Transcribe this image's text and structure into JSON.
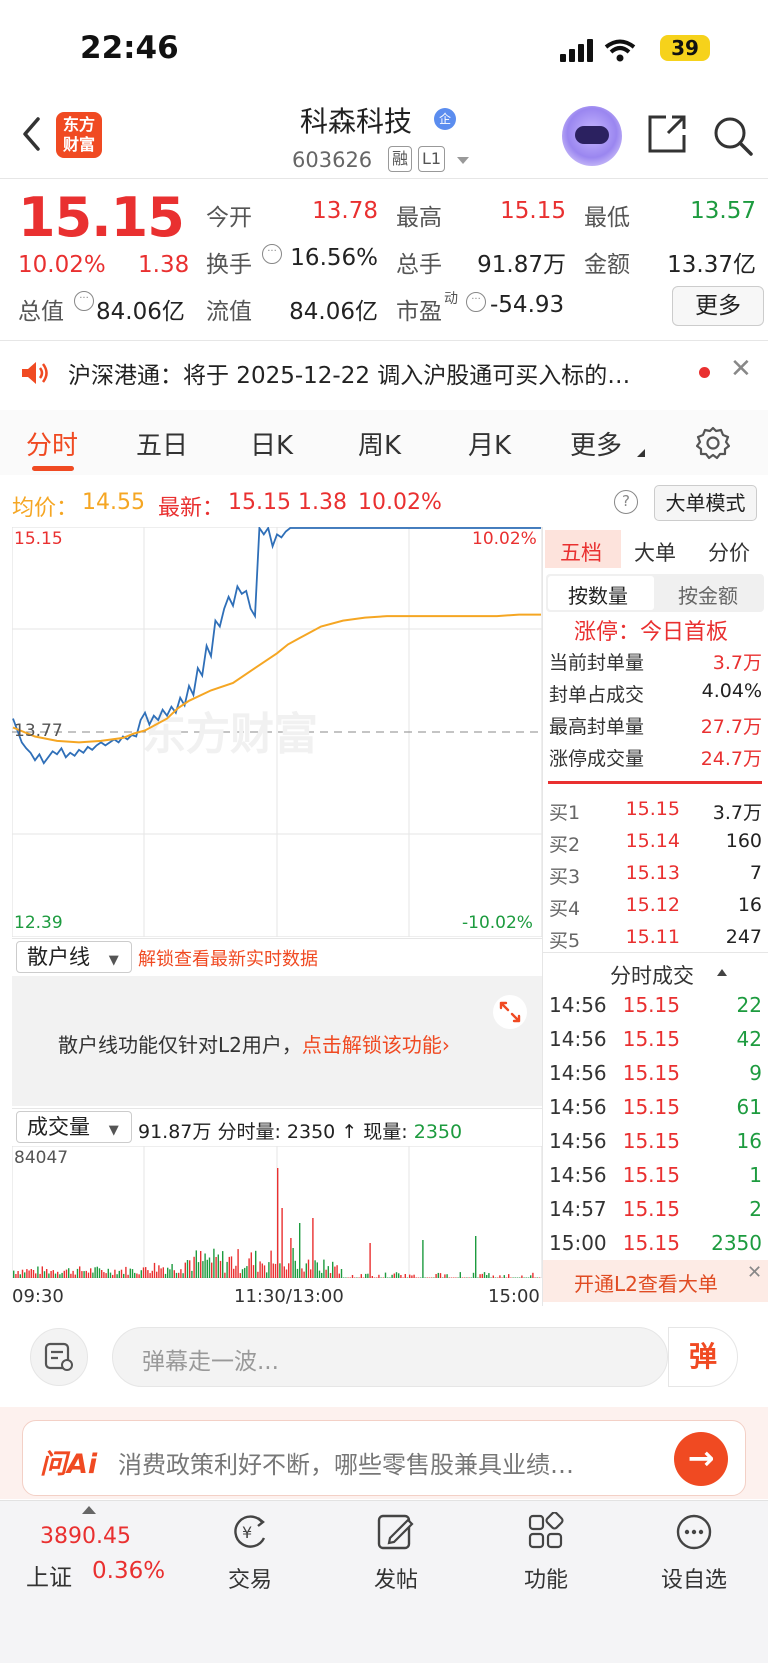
{
  "status_bar": {
    "time": "22:46",
    "battery": "39"
  },
  "header": {
    "logo_text": "东方财富",
    "stock_name": "科森科技",
    "name_badge": "企",
    "stock_code": "603626",
    "tag_margin": "融",
    "tag_level": "L1"
  },
  "quote": {
    "price": "15.15",
    "change_pct": "10.02%",
    "change": "1.38",
    "open_label": "今开",
    "open": "13.78",
    "high_label": "最高",
    "high": "15.15",
    "low_label": "最低",
    "low": "13.57",
    "turnover_label": "换手",
    "turnover": "16.56%",
    "volume_label": "总手",
    "volume": "91.87万",
    "amount_label": "金额",
    "amount": "13.37亿",
    "mktcap_label": "总值",
    "mktcap": "84.06亿",
    "float_label": "流值",
    "float_cap": "84.06亿",
    "pe_label": "市盈",
    "pe_sup": "动",
    "pe": "-54.93",
    "more_btn": "更多"
  },
  "notice": {
    "text": "沪深港通：将于 2025-12-22 调入沪股通可买入标的…"
  },
  "tabs": [
    "分时",
    "五日",
    "日K",
    "周K",
    "月K",
    "更多"
  ],
  "info_row": {
    "avg_label": "均价：",
    "avg": "14.55",
    "latest_label": "最新：",
    "latest": "15.15",
    "latest_chg": "1.38",
    "latest_pct": "10.02%",
    "big_order_btn": "大单模式"
  },
  "chart_labels": {
    "y_top": "15.15",
    "y_top_pct": "10.02%",
    "y_mid": "13.77",
    "y_bot": "12.39",
    "y_bot_pct": "-10.02%",
    "watermark": "东方财富"
  },
  "chart_data": {
    "type": "line",
    "title": "",
    "x_range": [
      "09:30",
      "15:00"
    ],
    "ylim": [
      12.39,
      15.15
    ],
    "prev_close": 13.77,
    "series": [
      {
        "name": "",
        "color": "#2f6fb8",
        "x": [
          0,
          2,
          4,
          6,
          8,
          10,
          12,
          14,
          16,
          18,
          20,
          22,
          24,
          26,
          28,
          30,
          32,
          34,
          36,
          38,
          40,
          42,
          44,
          46,
          48,
          50,
          52,
          54,
          56,
          58,
          60,
          62,
          64,
          66,
          68,
          70,
          72,
          74,
          76,
          78,
          80,
          82,
          84,
          86,
          88,
          90,
          92,
          94,
          96,
          98,
          100,
          102,
          104,
          106,
          108,
          110,
          112,
          114,
          116,
          118,
          120,
          122,
          124,
          126,
          128,
          130,
          132,
          134,
          136,
          138,
          140,
          142,
          144,
          146,
          148,
          150,
          152,
          154,
          156,
          158,
          160,
          162,
          164,
          166,
          168,
          170,
          172,
          174,
          176,
          178,
          180,
          182,
          184,
          186,
          188,
          190,
          192,
          194,
          196,
          198,
          200,
          202,
          204,
          206,
          208,
          210,
          212,
          214,
          216,
          218,
          220,
          222,
          224,
          226,
          228,
          230,
          232,
          234,
          236,
          238,
          240
        ],
        "y": [
          13.86,
          13.78,
          13.7,
          13.66,
          13.63,
          13.58,
          13.62,
          13.56,
          13.6,
          13.64,
          13.62,
          13.66,
          13.6,
          13.63,
          13.61,
          13.65,
          13.63,
          13.67,
          13.65,
          13.68,
          13.7,
          13.68,
          13.7,
          13.72,
          13.7,
          13.74,
          13.72,
          13.75,
          13.74,
          13.85,
          13.9,
          13.82,
          13.88,
          13.85,
          13.92,
          13.88,
          13.94,
          13.9,
          14.0,
          13.95,
          14.08,
          14.02,
          14.2,
          14.15,
          14.35,
          14.28,
          14.52,
          14.48,
          14.6,
          14.68,
          14.62,
          14.75,
          14.7,
          14.72,
          14.6,
          14.55,
          15.15,
          15.1,
          15.15,
          15.02,
          15.1,
          15.08,
          15.12,
          15.15,
          15.15,
          15.15,
          15.15,
          15.15,
          15.15,
          15.15,
          15.15,
          15.15,
          15.15,
          15.15,
          15.15,
          15.15,
          15.15,
          15.15,
          15.15,
          15.15,
          15.15,
          15.15,
          15.15,
          15.15,
          15.15,
          15.15,
          15.15,
          15.15,
          15.15,
          15.15,
          15.15,
          15.15,
          15.15,
          15.15,
          15.15,
          15.15,
          15.15,
          15.15,
          15.15,
          15.15,
          15.15,
          15.15,
          15.15,
          15.15,
          15.15,
          15.15,
          15.15,
          15.15,
          15.15,
          15.15,
          15.15,
          15.15,
          15.15,
          15.15,
          15.15,
          15.15,
          15.15,
          15.15,
          15.15,
          15.15,
          15.15
        ]
      },
      {
        "name": "",
        "color": "#f5a623",
        "x": [
          0,
          10,
          20,
          30,
          40,
          50,
          55,
          60,
          70,
          75,
          80,
          90,
          100,
          110,
          115,
          120,
          125,
          130,
          140,
          150,
          160,
          170,
          180,
          190,
          200,
          210,
          220,
          230,
          240
        ],
        "y": [
          13.8,
          13.74,
          13.71,
          13.7,
          13.71,
          13.73,
          13.76,
          13.78,
          13.86,
          13.93,
          13.98,
          14.05,
          14.1,
          14.2,
          14.25,
          14.3,
          14.36,
          14.4,
          14.48,
          14.52,
          14.54,
          14.55,
          14.55,
          14.55,
          14.55,
          14.55,
          14.55,
          14.56,
          14.56
        ]
      }
    ]
  },
  "right_panel": {
    "tabs": [
      "五档",
      "大单",
      "分价"
    ],
    "seg": [
      "按数量",
      "按金额"
    ],
    "limit_title": "涨停：今日首板",
    "stats": [
      {
        "label": "当前封单量",
        "value": "3.7万"
      },
      {
        "label": "封单占成交",
        "value": "4.04%"
      },
      {
        "label": "最高封单量",
        "value": "27.7万"
      },
      {
        "label": "涨停成交量",
        "value": "24.7万"
      }
    ],
    "bids": [
      {
        "label": "买1",
        "price": "15.15",
        "vol": "3.7万"
      },
      {
        "label": "买2",
        "price": "15.14",
        "vol": "160"
      },
      {
        "label": "买3",
        "price": "15.13",
        "vol": "7"
      },
      {
        "label": "买4",
        "price": "15.12",
        "vol": "16"
      },
      {
        "label": "买5",
        "price": "15.11",
        "vol": "247"
      }
    ],
    "trades_header": "分时成交",
    "trades": [
      {
        "time": "14:56",
        "price": "15.15",
        "vol": "22"
      },
      {
        "time": "14:56",
        "price": "15.15",
        "vol": "42"
      },
      {
        "time": "14:56",
        "price": "15.15",
        "vol": "9"
      },
      {
        "time": "14:56",
        "price": "15.15",
        "vol": "61"
      },
      {
        "time": "14:56",
        "price": "15.15",
        "vol": "16"
      },
      {
        "time": "14:56",
        "price": "15.15",
        "vol": "1"
      },
      {
        "time": "14:57",
        "price": "15.15",
        "vol": "2"
      },
      {
        "time": "15:00",
        "price": "15.15",
        "vol": "2350"
      }
    ],
    "l2_bar": "开通L2查看大单"
  },
  "sub_indicator": {
    "dropdown": "散户线",
    "unlock_link": "解锁查看最新实时数据",
    "locked_text": "散户线功能仅针对L2用户，",
    "locked_link": "点击解锁该功能"
  },
  "volume": {
    "dropdown": "成交量",
    "total": "91.87万",
    "minute_label": "分时量:",
    "minute_val": "2350",
    "now_label": "现量:",
    "now_val": "2350",
    "y_max": "84047",
    "time_labels": [
      "09:30",
      "11:30/13:00",
      "15:00"
    ]
  },
  "danmaku": {
    "placeholder": "弹幕走一波...",
    "send_btn": "弹"
  },
  "ai_bar": {
    "logo": "问Ai",
    "text": "消费政策利好不断，哪些零售股兼具业绩…"
  },
  "bottom_nav": {
    "index_value": "3890.45",
    "index_name": "上证",
    "index_pct": "0.36%",
    "items": [
      "交易",
      "发帖",
      "功能",
      "设自选"
    ]
  },
  "colors": {
    "accent": "#f04a22",
    "up": "#e93030",
    "down": "#1d9b3f",
    "price_line": "#2f6fb8",
    "avg_line": "#f5a623"
  }
}
